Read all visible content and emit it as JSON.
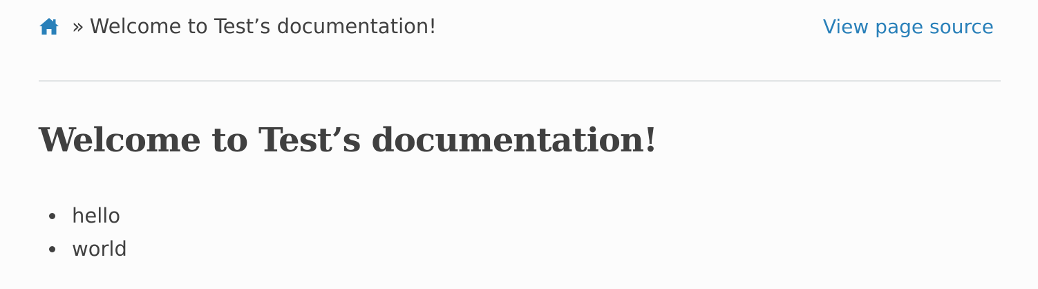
{
  "breadcrumb": {
    "home_icon": "home-icon",
    "separator": "»",
    "current": "Welcome to Test’s documentation!",
    "view_source": "View page source",
    "link_color": "#2980b9"
  },
  "main": {
    "title": "Welcome to Test’s documentation!",
    "items": [
      {
        "label": "hello"
      },
      {
        "label": "world"
      }
    ]
  }
}
